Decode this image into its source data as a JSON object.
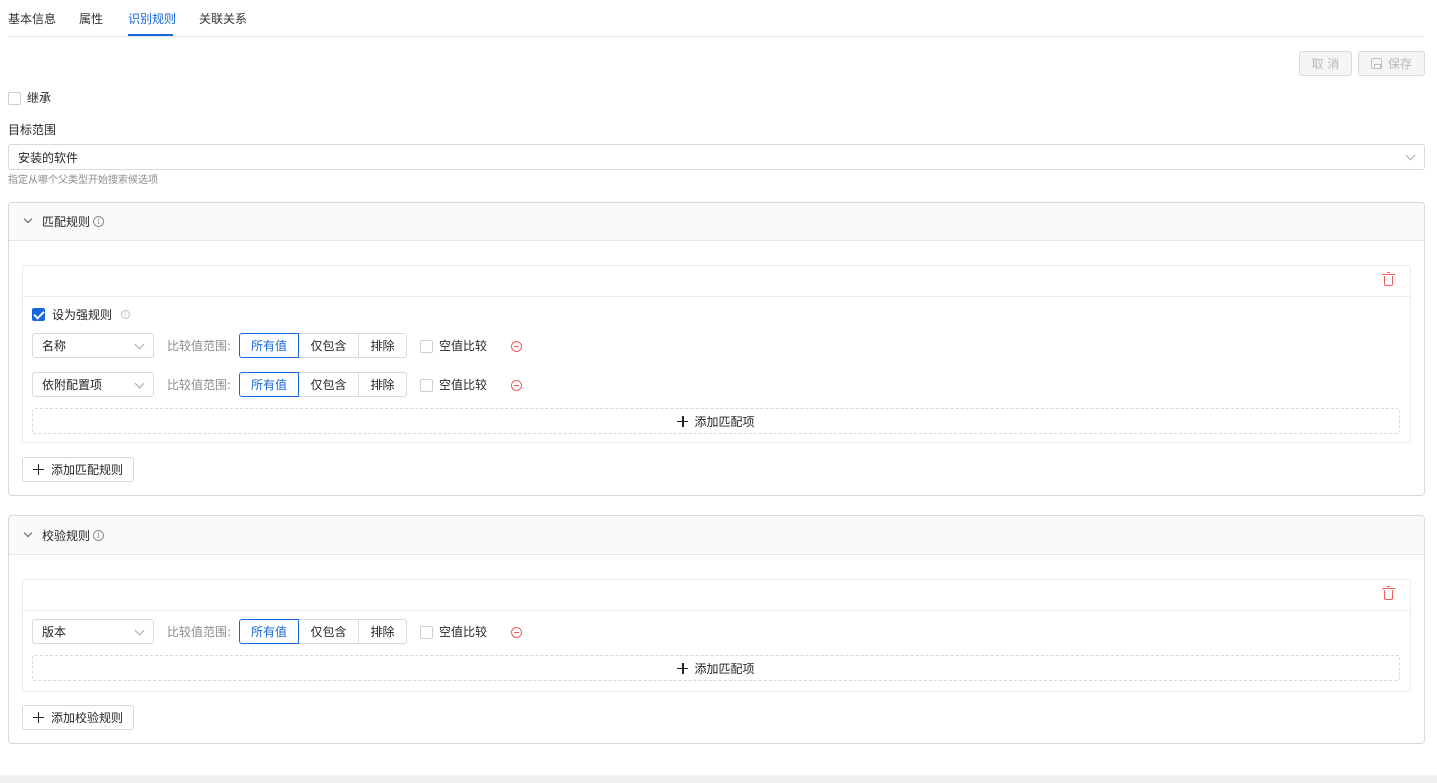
{
  "tabs": [
    {
      "label": "基本信息"
    },
    {
      "label": "属性"
    },
    {
      "label": "识别规则"
    },
    {
      "label": "关联关系"
    }
  ],
  "toolbar": {
    "cancel_label": "取 消",
    "save_label": "保存",
    "save_icon": "save-icon"
  },
  "inherit": {
    "label": "继承",
    "checked": false
  },
  "target_scope": {
    "label": "目标范围",
    "value": "安装的软件",
    "hint": "指定从哪个父类型开始搜索候选项"
  },
  "match_rules": {
    "title": "匹配规则",
    "strong_rule_label": "设为强规则",
    "strong_rule_checked": true,
    "rows": [
      {
        "field": "名称",
        "range_label": "比较值范围:",
        "options": [
          "所有值",
          "仅包含",
          "排除"
        ],
        "selected": "所有值",
        "null_compare_label": "空值比较"
      },
      {
        "field": "依附配置项",
        "range_label": "比较值范围:",
        "options": [
          "所有值",
          "仅包含",
          "排除"
        ],
        "selected": "所有值",
        "null_compare_label": "空值比较"
      }
    ],
    "add_item_label": "添加匹配项",
    "add_rule_label": "添加匹配规则"
  },
  "validation_rules": {
    "title": "校验规则",
    "rows": [
      {
        "field": "版本",
        "range_label": "比较值范围:",
        "options": [
          "所有值",
          "仅包含",
          "排除"
        ],
        "selected": "所有值",
        "null_compare_label": "空值比较"
      }
    ],
    "add_item_label": "添加匹配项",
    "add_rule_label": "添加校验规则"
  },
  "colors": {
    "accent": "#1668dc",
    "danger": "#f15b5b"
  }
}
